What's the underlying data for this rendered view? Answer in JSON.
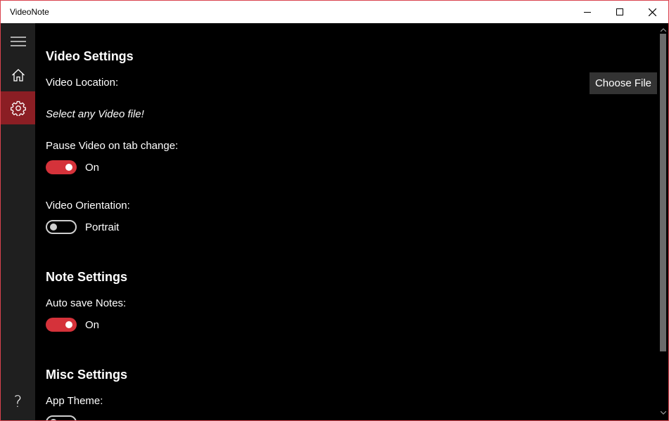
{
  "window": {
    "title": "VideoNote"
  },
  "nav": {
    "items": [
      {
        "name": "menu",
        "icon": "hamburger-icon"
      },
      {
        "name": "home",
        "icon": "home-icon"
      },
      {
        "name": "settings",
        "icon": "gear-icon",
        "selected": true
      },
      {
        "name": "help",
        "icon": "question-icon",
        "glyph": "?"
      }
    ]
  },
  "video_settings": {
    "heading": "Video Settings",
    "location_label": "Video Location:",
    "choose_file_label": "Choose File",
    "location_hint": "Select any Video file!",
    "pause_label": "Pause Video on tab change:",
    "pause_state": "On",
    "orientation_label": "Video Orientation:",
    "orientation_state": "Portrait"
  },
  "note_settings": {
    "heading": "Note Settings",
    "autosave_label": "Auto save Notes:",
    "autosave_state": "On"
  },
  "misc_settings": {
    "heading": "Misc Settings",
    "theme_label": "App Theme:"
  },
  "colors": {
    "accent": "#d5323a",
    "nav_selected": "#8b1e24",
    "nav_bg": "#1f1f1f",
    "content_bg": "#000000",
    "window_border": "#d9434e"
  }
}
